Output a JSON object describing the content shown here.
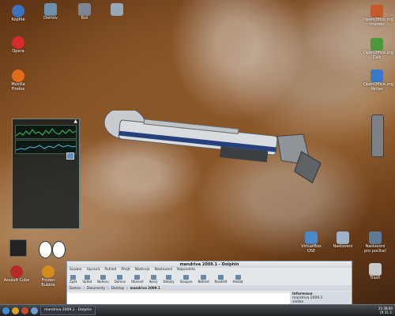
{
  "desktop": {
    "left_icons": [
      {
        "label": "Koplite",
        "icon": "home-icon",
        "color": "#3a74c0"
      },
      {
        "label": "Opera",
        "icon": "opera-icon",
        "color": "#d72a2a"
      },
      {
        "label": "Mozilla Firefox",
        "icon": "firefox-icon",
        "color": "#e66a1c"
      }
    ],
    "top_icons": [
      {
        "label": "Domov",
        "icon": "folder-icon",
        "color": "#6f8fae"
      },
      {
        "label": "Koš",
        "icon": "trash-icon",
        "color": "#7d8794"
      },
      {
        "label": "",
        "icon": "folder-icon",
        "color": "#9aa8b5"
      }
    ],
    "right_icons": [
      {
        "label": "OpenOffice.org Impress",
        "icon": "impress-icon",
        "color": "#c55a2b"
      },
      {
        "label": "OpenOffice.org Calc",
        "icon": "calc-icon",
        "color": "#4a9a3a"
      },
      {
        "label": "OpenOffice.org Writer",
        "icon": "writer-icon",
        "color": "#3d78c8"
      }
    ],
    "bottom_right_icons": [
      {
        "label": "VirtualBox OSE",
        "icon": "virtualbox-icon",
        "color": "#4a88c7"
      },
      {
        "label": "Nastavení",
        "icon": "tools-icon",
        "color": "#9fb3c8"
      },
      {
        "label": "Nastavení pro počítač",
        "icon": "monitor-icon",
        "color": "#5f7a95"
      },
      {
        "label": "Trash",
        "icon": "trashcan-icon",
        "color": "#c8c8c8"
      }
    ],
    "bottom_left_icons": [
      {
        "label": "Assault Cube",
        "icon": "assaultcube-icon",
        "color": "#b52a2a"
      },
      {
        "label": "Frozen Bubble",
        "icon": "frozenbubble-icon",
        "color": "#d68a1a"
      }
    ]
  },
  "sysmon": {
    "rows": [
      "",
      "",
      "",
      "",
      "",
      ""
    ],
    "icons": [
      "tux-icon",
      "monitor-icon"
    ]
  },
  "dolphin": {
    "title": "mandriva 2009.1 - Dolphin",
    "menu": [
      "Soubor",
      "Upravit",
      "Pohled",
      "Přejít",
      "Nástroje",
      "Nastavení",
      "Nápověda"
    ],
    "toolbar": [
      "Zpět",
      "Vpřed",
      "Nahoru",
      "Domov",
      "Obnovit",
      "Ikony",
      "Detaily",
      "Sloupce",
      "Náhled",
      "Rozdělit",
      "Hledat"
    ],
    "path": [
      "Domov",
      "Dokumenty",
      "Desktop",
      "mandriva 2009.1"
    ],
    "info_title": "Informace",
    "info_name": "mandriva 2009.1",
    "info_item": "složka"
  },
  "taskbar": {
    "tasks": [
      "mandriva 2009.1 - Dolphin"
    ],
    "clock_time": "21:38:00",
    "clock_date": "Út 31.3."
  }
}
